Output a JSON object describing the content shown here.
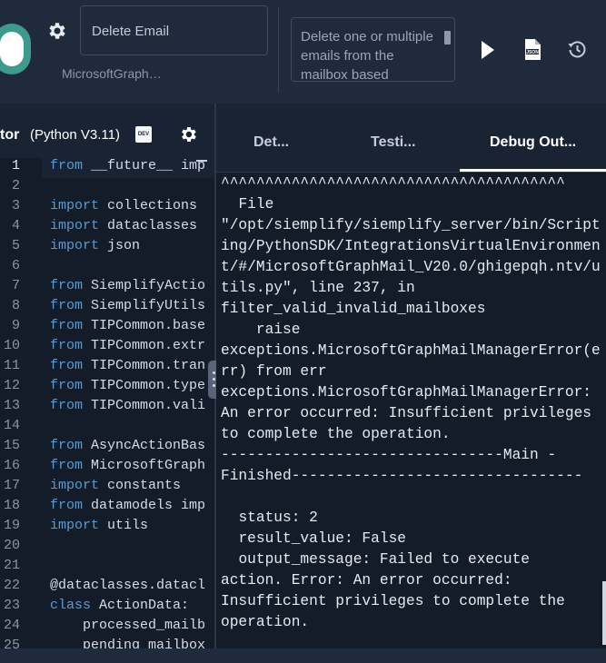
{
  "action": {
    "name": "Delete Email",
    "integration": "MicrosoftGraph…",
    "description": "Delete one or multiple emails from the mailbox based"
  },
  "editor": {
    "title": "tor",
    "version": "(Python V3.11)",
    "badge": "DEV",
    "lines": [
      {
        "n": "1",
        "kw": "from",
        "rest": " __future__ imp"
      },
      {
        "n": "2",
        "kw": "",
        "rest": ""
      },
      {
        "n": "3",
        "kw": "import",
        "rest": " collections"
      },
      {
        "n": "4",
        "kw": "import",
        "rest": " dataclasses"
      },
      {
        "n": "5",
        "kw": "import",
        "rest": " json"
      },
      {
        "n": "6",
        "kw": "",
        "rest": ""
      },
      {
        "n": "7",
        "kw": "from",
        "rest": " SiemplifyActio"
      },
      {
        "n": "8",
        "kw": "from",
        "rest": " SiemplifyUtils"
      },
      {
        "n": "9",
        "kw": "from",
        "rest": " TIPCommon.base"
      },
      {
        "n": "10",
        "kw": "from",
        "rest": " TIPCommon.extr"
      },
      {
        "n": "11",
        "kw": "from",
        "rest": " TIPCommon.tran"
      },
      {
        "n": "12",
        "kw": "from",
        "rest": " TIPCommon.type"
      },
      {
        "n": "13",
        "kw": "from",
        "rest": " TIPCommon.vali"
      },
      {
        "n": "14",
        "kw": "",
        "rest": ""
      },
      {
        "n": "15",
        "kw": "from",
        "rest": " AsyncActionBas"
      },
      {
        "n": "16",
        "kw": "from",
        "rest": " MicrosoftGraph"
      },
      {
        "n": "17",
        "kw": "import",
        "rest": " constants"
      },
      {
        "n": "18",
        "kw": "from",
        "rest": " datamodels imp"
      },
      {
        "n": "19",
        "kw": "import",
        "rest": " utils"
      },
      {
        "n": "20",
        "kw": "",
        "rest": ""
      },
      {
        "n": "21",
        "kw": "",
        "rest": ""
      },
      {
        "n": "22",
        "kw": "",
        "rest": "@dataclasses.datacl"
      },
      {
        "n": "23",
        "kw": "class",
        "rest": " ActionData:"
      },
      {
        "n": "24",
        "kw": "",
        "rest": "    processed_mailb"
      },
      {
        "n": "25",
        "kw": "",
        "rest": "    pending_mailbox"
      }
    ]
  },
  "tabs": [
    "Det...",
    "Testi...",
    "Debug Out..."
  ],
  "active_tab": "Debug Out...",
  "console": {
    "output": "^^^^^^^^^^^^^^^^^^^^^^^^^^^^^^^^^^^^^^^\n  File\n\"/opt/siemplify/siemplify_server/bin/Scripting/PythonSDK/IntegrationsVirtualEnvironment/#/MicrosoftGraphMail_V20.0/ghigepqh.ntv/utils.py\", line 237, in\nfilter_valid_invalid_mailboxes\n    raise\nexceptions.MicrosoftGraphMailManagerError(err) from err\nexceptions.MicrosoftGraphMailManagerError: An error occurred: Insufficient privileges to complete the operation.\n--------------------------------Main -\nFinished---------------------------------\n\n  status: 2\n  result_value: False\n  output_message: Failed to execute\naction. Error: An error occurred:\nInsufficient privileges to complete the\noperation."
  },
  "colors": {
    "toggle_on": "#3f9a8e",
    "keyword": "#569cd6",
    "background": "#1a2333",
    "editor_background": "#141c29"
  }
}
